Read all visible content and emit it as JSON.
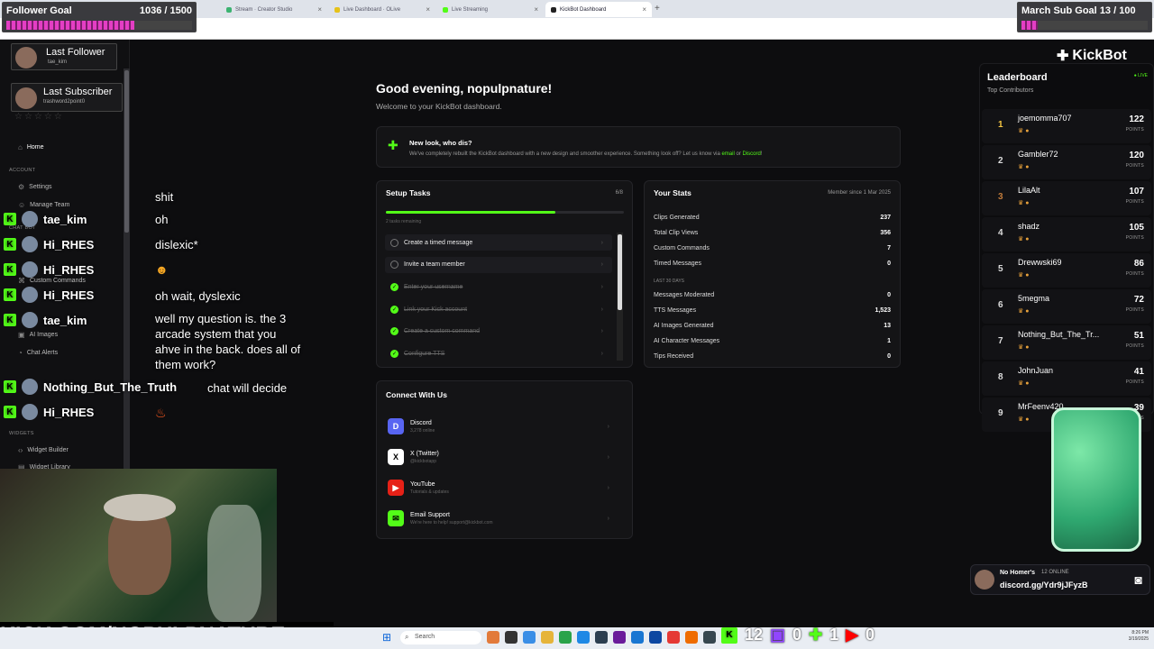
{
  "browser": {
    "tabs": [
      {
        "label": "Stream · Creator Studio",
        "color": "#3cb371"
      },
      {
        "label": "Live Dashboard · OLive",
        "color": "#e6c21a"
      },
      {
        "label": "Live Streaming",
        "color": "#53fc18"
      },
      {
        "label": "KickBot Dashboard",
        "color": "#222"
      }
    ]
  },
  "overlays": {
    "follower_goal": {
      "label": "Follower Goal",
      "value": "1036 / 1500"
    },
    "sub_goal": {
      "label": "March Sub Goal",
      "value": "13 / 100"
    },
    "last_follower": {
      "label": "Last Follower",
      "name": "tae_kim"
    },
    "last_subscriber": {
      "label": "Last Subscriber",
      "name": "trashword2point0"
    },
    "footer_url": "KICK.COM/NOPULPNATURE",
    "counters": {
      "kick": "12",
      "twitch": "0",
      "sub": "1",
      "youtube": "0"
    },
    "discord": {
      "title": "No Homer's",
      "online": "12 ONLINE",
      "link": "discord.gg/Ydr9jJFyzB"
    }
  },
  "chat": {
    "users": [
      "tae_kim",
      "Hi_RHES",
      "Hi_RHES",
      "Hi_RHES",
      "tae_kim",
      "Nothing_But_The_Truth",
      "Hi_RHES"
    ],
    "messages": [
      "shit",
      "oh",
      "dislexic*",
      "oh wait, dyslexic",
      "well my question is. the 3 arcade system that you ahve in the back. does all of them work?",
      "chat will decide"
    ]
  },
  "sidebar": {
    "home": "Home",
    "account_head": "ACCOUNT",
    "settings": "Settings",
    "manage_team": "Manage Team",
    "chat_head": "CHAT BOT",
    "custom_commands": "Custom Commands",
    "ai_images": "AI Images",
    "chat_alerts": "Chat Alerts",
    "widgets_head": "WIDGETS",
    "widget_builder": "Widget Builder",
    "widget_library": "Widget Library"
  },
  "brand": "KickBot",
  "main": {
    "greeting": "Good evening, nopulpnature!",
    "welcome": "Welcome to your KickBot dashboard.",
    "notice_title": "New look, who dis?",
    "notice_text_pre": "We've completely rebuilt the KickBot dashboard with a new design and smoother experience. Something look off? Let us know via",
    "notice_link1": "email",
    "notice_or": "or",
    "notice_link2": "Discord",
    "setup": {
      "title": "Setup Tasks",
      "count": "6/8",
      "remaining": "2 tasks remaining",
      "progress": 0.75,
      "tasks": [
        {
          "label": "Create a timed message",
          "done": false
        },
        {
          "label": "Invite a team member",
          "done": false
        },
        {
          "label": "Enter your username",
          "done": true
        },
        {
          "label": "Link your Kick account",
          "done": true
        },
        {
          "label": "Create a custom command",
          "done": true
        },
        {
          "label": "Configure TTS",
          "done": true
        }
      ]
    },
    "stats": {
      "title": "Your Stats",
      "member_since": "Member since 1 Mar 2025",
      "rows": [
        {
          "label": "Clips Generated",
          "value": "237"
        },
        {
          "label": "Total Clip Views",
          "value": "356"
        },
        {
          "label": "Custom Commands",
          "value": "7"
        },
        {
          "label": "Timed Messages",
          "value": "0"
        }
      ],
      "last30": "LAST 30 DAYS",
      "rows30": [
        {
          "label": "Messages Moderated",
          "value": "0"
        },
        {
          "label": "TTS Messages",
          "value": "1,523"
        },
        {
          "label": "AI Images Generated",
          "value": "13"
        },
        {
          "label": "AI Character Messages",
          "value": "1"
        },
        {
          "label": "Tips Received",
          "value": "0"
        }
      ]
    },
    "connect": {
      "title": "Connect With Us",
      "items": [
        {
          "name": "Discord",
          "sub": "3,278 online",
          "icon": "D",
          "color": "#5865f2"
        },
        {
          "name": "X (Twitter)",
          "sub": "@kickbotapp",
          "icon": "X",
          "color": "#fff"
        },
        {
          "name": "YouTube",
          "sub": "Tutorials & updates",
          "icon": "▶",
          "color": "#e62117"
        },
        {
          "name": "Email Support",
          "sub": "We're here to help! support@kickbot.com",
          "icon": "✉",
          "color": "#53fc18"
        }
      ]
    }
  },
  "leaderboard": {
    "title": "Leaderboard",
    "subtitle": "Top Contributors",
    "status": "● LIVE",
    "points_label": "POINTS",
    "rows": [
      {
        "rank": "1",
        "name": "joemomma707",
        "points": "122"
      },
      {
        "rank": "2",
        "name": "Gambler72",
        "points": "120"
      },
      {
        "rank": "3",
        "name": "LilaAlt",
        "points": "107"
      },
      {
        "rank": "4",
        "name": "shadz",
        "points": "105"
      },
      {
        "rank": "5",
        "name": "Drewwski69",
        "points": "86"
      },
      {
        "rank": "6",
        "name": "5megma",
        "points": "72"
      },
      {
        "rank": "7",
        "name": "Nothing_But_The_Tr...",
        "points": "51"
      },
      {
        "rank": "8",
        "name": "JohnJuan",
        "points": "41"
      },
      {
        "rank": "9",
        "name": "MrFeenv420",
        "points": "39"
      }
    ]
  },
  "taskbar": {
    "search": "Search",
    "time": "8:26 PM",
    "date": "3/19/2025"
  }
}
